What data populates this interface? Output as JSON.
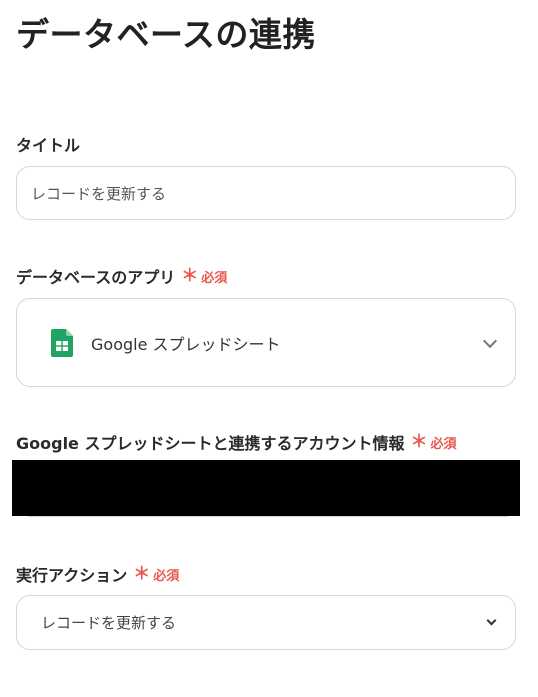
{
  "page": {
    "title": "データベースの連携"
  },
  "fields": {
    "title_field": {
      "label": "タイトル",
      "value": "レコードを更新する"
    },
    "database_app": {
      "label": "データベースのアプリ",
      "required_mark": "＊",
      "required_label": "必須",
      "selected_app": "Google スプレッドシート",
      "app_icon": "google-sheets-icon"
    },
    "account_info": {
      "label": "Google スプレッドシートと連携するアカウント情報",
      "required_mark": "＊",
      "required_label": "必須"
    },
    "action": {
      "label": "実行アクション",
      "required_mark": "＊",
      "required_label": "必須",
      "selected": "レコードを更新する"
    }
  },
  "colors": {
    "required": "#e8594f",
    "sheets_green": "#1fa463"
  }
}
